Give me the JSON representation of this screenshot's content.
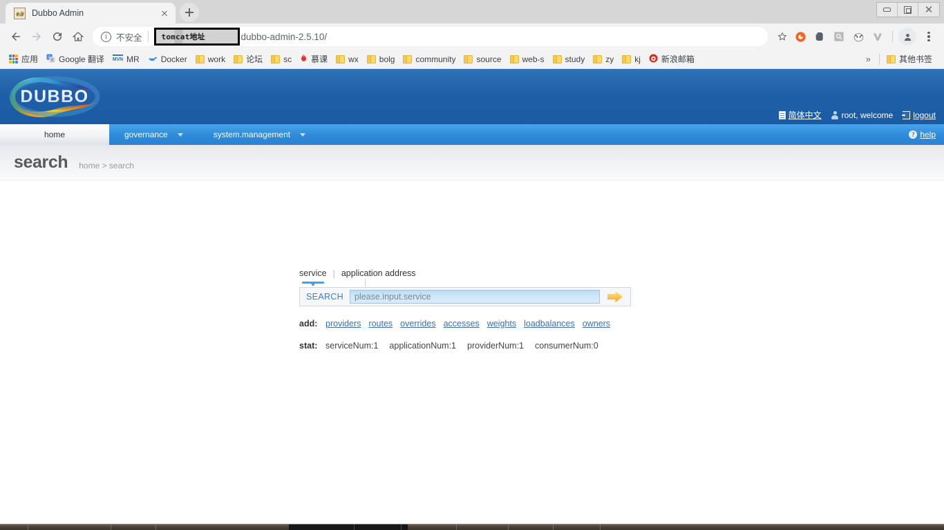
{
  "browser": {
    "tab": {
      "title": "Dubbo Admin",
      "favicon": "dubbo-favicon",
      "close": "×"
    },
    "newtab_label": "+",
    "window_controls": {
      "minimize": "minimize",
      "maximize": "maximize",
      "close": "close"
    },
    "nav": {
      "back": "back-arrow",
      "forward": "forward-arrow",
      "reload": "reload-arrow",
      "home": "home-icon"
    },
    "omnibox": {
      "security_label": "不安全",
      "redacted_text": "tomcat地址",
      "url_visible": "dubbo-admin-2.5.10/",
      "bookmark_star": "☆"
    },
    "extensions": [
      "firefox-icon",
      "evernote-icon",
      "search-box-icon",
      "cat-icon",
      "v-icon"
    ],
    "profile_icon": "profile-avatar",
    "menu_icon": "three-dot-menu",
    "bookmarks": [
      {
        "label": "应用",
        "icon": "apps-grid"
      },
      {
        "label": "Google 翻译",
        "icon": "google-translate"
      },
      {
        "label": "MR",
        "icon": "mvn-icon"
      },
      {
        "label": "Docker",
        "icon": "docker-whale"
      },
      {
        "label": "work",
        "icon": "folder"
      },
      {
        "label": "论坛",
        "icon": "folder"
      },
      {
        "label": "sc",
        "icon": "folder"
      },
      {
        "label": "慕课",
        "icon": "flame-icon"
      },
      {
        "label": "wx",
        "icon": "folder"
      },
      {
        "label": "bolg",
        "icon": "folder"
      },
      {
        "label": "community",
        "icon": "folder"
      },
      {
        "label": "source",
        "icon": "folder"
      },
      {
        "label": "web-s",
        "icon": "folder"
      },
      {
        "label": "study",
        "icon": "folder"
      },
      {
        "label": "zy",
        "icon": "folder"
      },
      {
        "label": "kj",
        "icon": "folder"
      },
      {
        "label": "新浪邮箱",
        "icon": "weibo-icon"
      }
    ],
    "bookmarks_overflow": "»",
    "other_bookmarks": {
      "label": "其他书签",
      "icon": "folder"
    }
  },
  "app": {
    "logo_text": "DUBBO",
    "header_links": {
      "language": "简体中文",
      "welcome": "root, welcome",
      "logout": "logout"
    },
    "nav_tabs": [
      {
        "label": "home",
        "active": true,
        "has_caret": false
      },
      {
        "label": "governance",
        "active": false,
        "has_caret": true
      },
      {
        "label": "system.management",
        "active": false,
        "has_caret": true
      }
    ],
    "help_label": "help",
    "page_title": "search",
    "breadcrumb": "home > search",
    "search_panel": {
      "tabs": [
        {
          "label": "service",
          "selected": true
        },
        {
          "label": "application address",
          "selected": false
        }
      ],
      "tab_divider": "|",
      "search_button_label": "SEARCH",
      "input_placeholder": "please.input.service",
      "input_value": "",
      "go_icon": "right-arrow-icon"
    },
    "add_row": {
      "key": "add:",
      "links": [
        "providers",
        "routes",
        "overrides",
        "accesses",
        "weights",
        "loadbalances",
        "owners"
      ]
    },
    "stat_row": {
      "key": "stat:",
      "items": [
        "serviceNum:1",
        "applicationNum:1",
        "providerNum:1",
        "consumerNum:0"
      ]
    }
  },
  "colors": {
    "header_blue": "#1f5fa8",
    "nav_blue": "#2e8ada",
    "link_blue": "#3f6fa8",
    "accent_orange": "#f6c64a"
  }
}
